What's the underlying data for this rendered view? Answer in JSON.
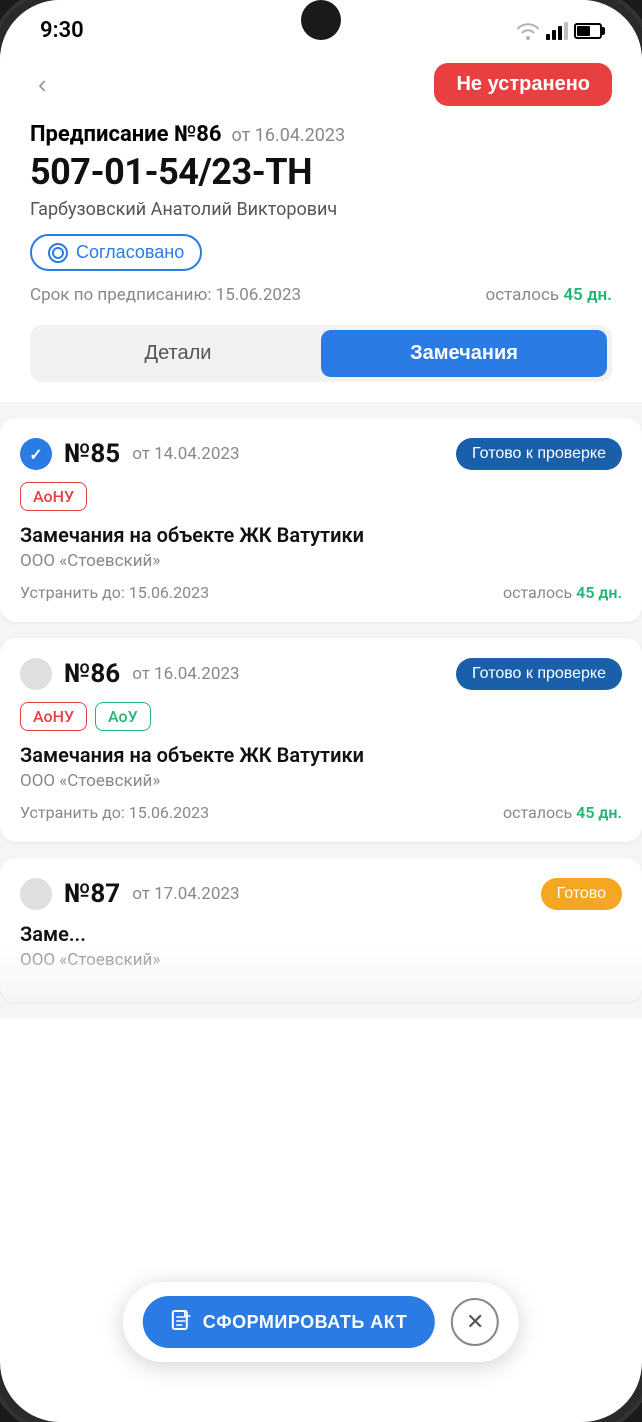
{
  "statusBar": {
    "time": "9:30"
  },
  "header": {
    "backLabel": "‹",
    "statusBadge": "Не устранено"
  },
  "prescription": {
    "label": "Предписание №86",
    "date": "от 16.04.2023",
    "number": "507-01-54/23-ТН",
    "author": "Гарбузовский Анатолий Викторович",
    "agreedLabel": "Согласовано",
    "deadlineLabel": "Срок по предписанию: 15.06.2023",
    "remainingLabel": "осталось",
    "remainingValue": "45 дн."
  },
  "tabs": {
    "details": "Детали",
    "remarks": "Замечания"
  },
  "remarks": [
    {
      "number": "№85",
      "date": "от 14.04.2023",
      "status": "Готово к проверке",
      "tags": [
        "АоНУ"
      ],
      "tagsColor": [
        "red"
      ],
      "title": "Замечания на объекте ЖК Ватутики",
      "company": "ООО «Стоевский»",
      "deadlineLabel": "Устранить до: 15.06.2023",
      "remainingLabel": "осталось",
      "remainingValue": "45 дн.",
      "checked": true
    },
    {
      "number": "№86",
      "date": "от 16.04.2023",
      "status": "Готово к проверке",
      "tags": [
        "АоНУ",
        "АоУ"
      ],
      "tagsColor": [
        "red",
        "green"
      ],
      "title": "Замечания на объекте ЖК Ватутики",
      "company": "ООО «Стоевский»",
      "deadlineLabel": "Устранить до: 15.06.2023",
      "remainingLabel": "осталось",
      "remainingValue": "45 дн.",
      "checked": false
    },
    {
      "number": "№87",
      "date": "от 17.04.2023",
      "status": "Готово",
      "tags": [],
      "tagsColor": [],
      "title": "Заме...",
      "company": "ООО «Стоевский»",
      "deadlineLabel": "",
      "remainingLabel": "",
      "remainingValue": "",
      "checked": false,
      "partial": true,
      "statusOrange": true
    }
  ],
  "actionBar": {
    "formButtonLabel": "СФОРМИРОВАТЬ АКТ",
    "closeLabel": "✕"
  }
}
